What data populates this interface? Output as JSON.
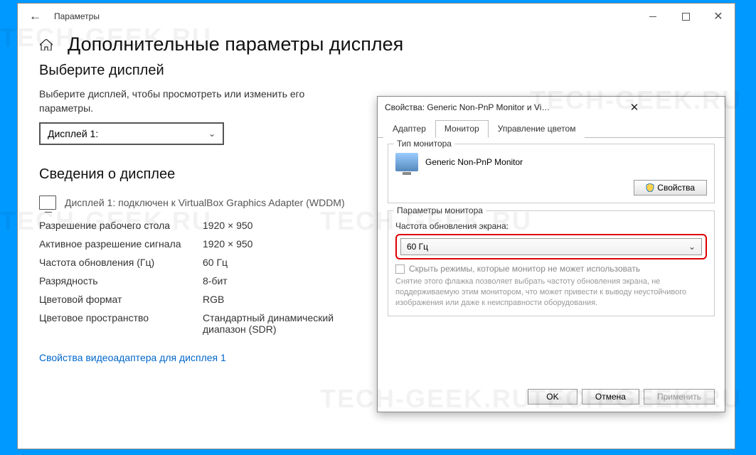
{
  "window": {
    "title": "Параметры",
    "page_title": "Дополнительные параметры дисплея"
  },
  "select_display": {
    "heading": "Выберите дисплей",
    "desc": "Выберите дисплей, чтобы просмотреть или изменить его параметры.",
    "selected": "Дисплей 1:"
  },
  "display_info": {
    "heading": "Сведения о дисплее",
    "connection": "Дисплей 1: подключен к VirtualBox Graphics Adapter (WDDM)",
    "rows": [
      {
        "label": "Разрешение рабочего стола",
        "value": "1920 × 950"
      },
      {
        "label": "Активное разрешение сигнала",
        "value": "1920 × 950"
      },
      {
        "label": "Частота обновления (Гц)",
        "value": "60 Гц"
      },
      {
        "label": "Разрядность",
        "value": "8-бит"
      },
      {
        "label": "Цветовой формат",
        "value": "RGB"
      },
      {
        "label": "Цветовое пространство",
        "value": "Стандартный динамический диапазон (SDR)"
      }
    ],
    "link": "Свойства видеоадаптера для дисплея 1"
  },
  "dialog": {
    "title": "Свойства: Generic Non-PnP Monitor и VirtualBox Graphics Adapte...",
    "tabs": [
      "Адаптер",
      "Монитор",
      "Управление цветом"
    ],
    "active_tab": 1,
    "monitor_type": {
      "legend": "Тип монитора",
      "name": "Generic Non-PnP Monitor",
      "properties_btn": "Свойства"
    },
    "monitor_params": {
      "legend": "Параметры монитора",
      "freq_legend": "Частота обновления экрана:",
      "freq_value": "60 Гц",
      "hide_modes": "Скрыть режимы, которые монитор не может использовать",
      "hint": "Снятие этого флажка позволяет выбрать частоту обновления экрана, не поддерживаемую этим монитором, что может привести к выводу неустойчивого изображения или даже к неисправности оборудования."
    },
    "buttons": {
      "ok": "OK",
      "cancel": "Отмена",
      "apply": "Применить"
    }
  },
  "watermark": "TECH-GEEK.RU"
}
